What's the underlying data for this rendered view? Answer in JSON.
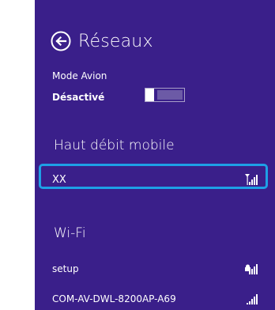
{
  "panel": {
    "title": "Réseaux",
    "bg_color": "#3a1f8a",
    "accent_color": "#1ea0e6"
  },
  "airplane_mode": {
    "label": "Mode Avion",
    "state": "Désactivé",
    "enabled": false
  },
  "mobile_broadband": {
    "heading": "Haut débit mobile",
    "networks": [
      {
        "name": "XX",
        "icon": "mobile-signal-icon",
        "selected": true
      }
    ]
  },
  "wifi": {
    "heading": "Wi-Fi",
    "networks": [
      {
        "name": "setup",
        "icon": "wifi-signal-secured-icon"
      },
      {
        "name": "COM-AV-DWL-8200AP-A69",
        "icon": "wifi-signal-icon"
      }
    ]
  }
}
